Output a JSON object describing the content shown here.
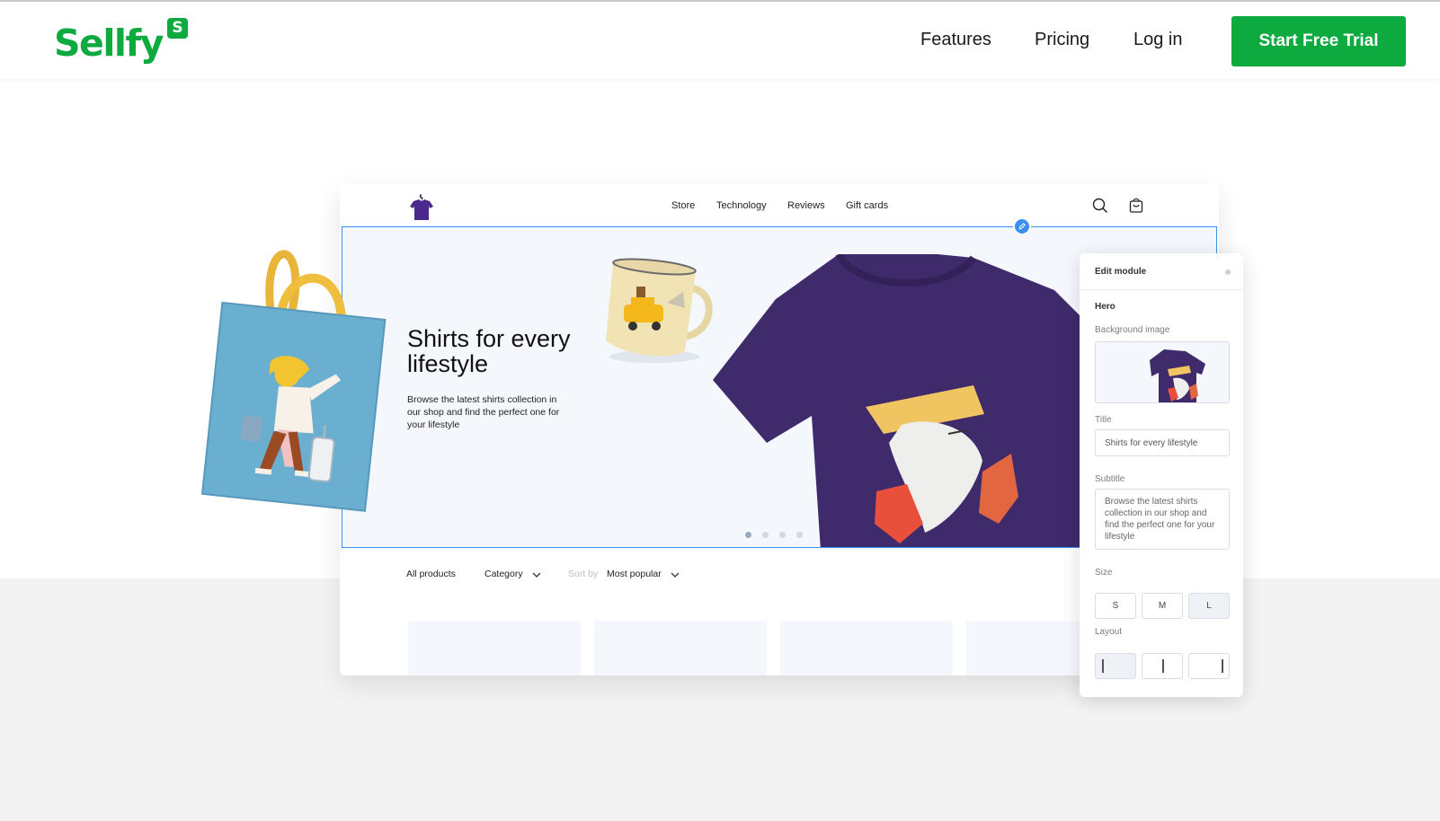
{
  "header": {
    "logo_text": "Sellfy",
    "logo_badge": "S",
    "nav": {
      "features": "Features",
      "pricing": "Pricing",
      "login": "Log in"
    },
    "cta": "Start Free Trial",
    "brand_color": "#0dab3f"
  },
  "mockup": {
    "shop_nav": [
      "Store",
      "Technology",
      "Reviews",
      "Gift cards"
    ],
    "hero": {
      "title": "Shirts for every lifestyle",
      "subtitle": "Browse the latest shirts collection in our shop and find the perfect one for your lifestyle",
      "slides": 4,
      "active_slide": 0
    },
    "filters": {
      "all_products": "All products",
      "category": "Category",
      "sort_label": "Sort by",
      "sort_value": "Most popular"
    }
  },
  "panel": {
    "title": "Edit module",
    "section": "Hero",
    "bg_label": "Background image",
    "title_label": "Title",
    "title_value": "Shirts for every lifestyle",
    "subtitle_label": "Subtitle",
    "subtitle_value": "Browse the latest shirts collection in our shop and find the perfect one for your lifestyle",
    "size_label": "Size",
    "sizes": [
      "S",
      "M",
      "L"
    ],
    "selected_size": "L",
    "layout_label": "Layout",
    "accent_color": "#3c8ef0"
  }
}
